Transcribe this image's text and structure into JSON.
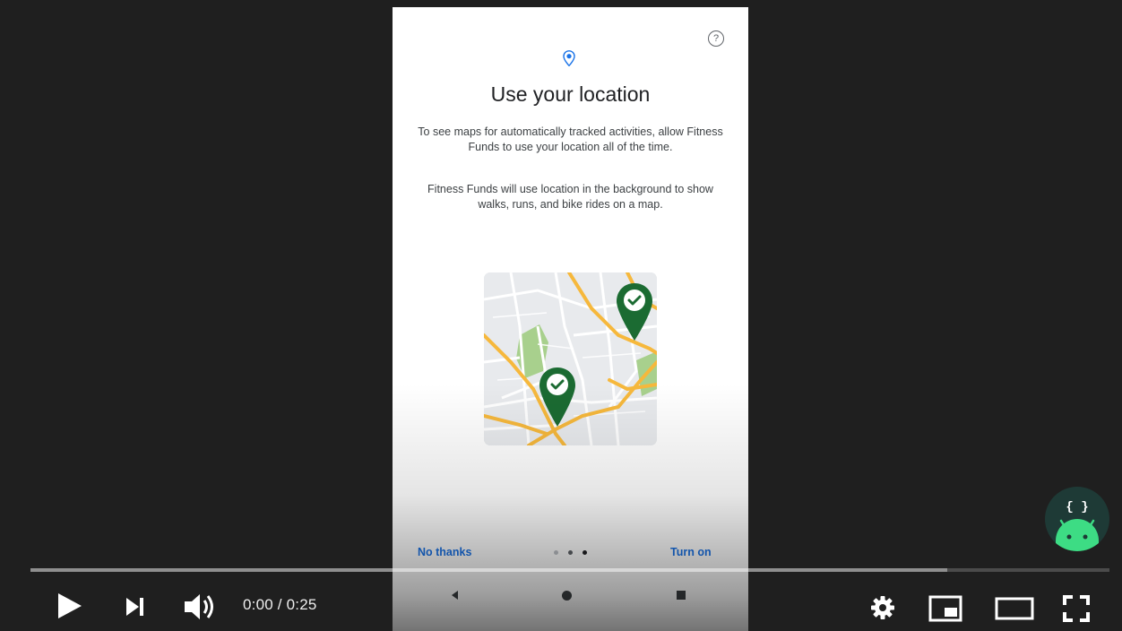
{
  "phone_screen": {
    "title": "Use your location",
    "paragraph1": "To see maps for automatically tracked activities, allow Fitness Funds to use your location all of the time.",
    "paragraph2": "Fitness Funds will use location in the background to show walks, runs, and bike rides on a map.",
    "help_icon_text": "?",
    "no_thanks_label": "No thanks",
    "turn_on_label": "Turn on",
    "page_indicator": {
      "total": 3,
      "current": 2
    }
  },
  "player": {
    "time_display": "0:00 / 0:25",
    "progress_fraction": 0.0,
    "buffered_fraction": 0.85,
    "channel_badge_text": "{ }"
  },
  "icons": {
    "play": "play-icon",
    "next": "next-icon",
    "volume": "volume-icon",
    "settings": "settings-icon",
    "miniplayer": "miniplayer-icon",
    "theater": "theater-mode-icon",
    "fullscreen": "fullscreen-icon"
  },
  "colors": {
    "player_bg": "#1f1f1f",
    "link_blue": "#1a73e8",
    "pin_green": "#1b6b32",
    "route_orange": "#f6b83c",
    "park_green": "#a8d08d",
    "avatar_bg": "#1e3a36",
    "android_green": "#3ddc84"
  }
}
